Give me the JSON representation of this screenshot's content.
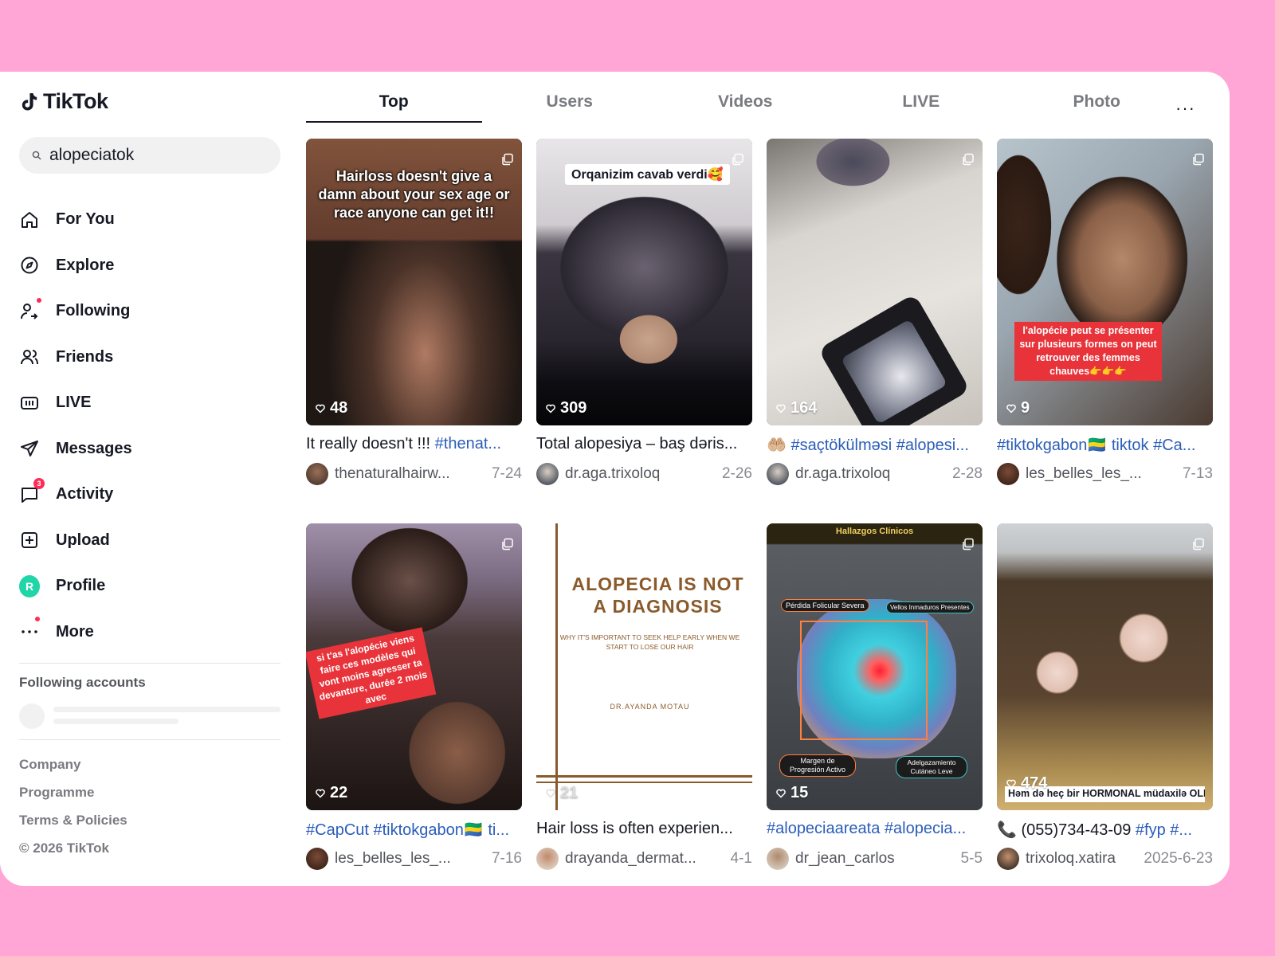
{
  "brand": {
    "name": "TikTok"
  },
  "search": {
    "query": "alopeciatok"
  },
  "nav": [
    {
      "key": "for-you",
      "label": "For You",
      "icon": "home-icon"
    },
    {
      "key": "explore",
      "label": "Explore",
      "icon": "compass-icon"
    },
    {
      "key": "following",
      "label": "Following",
      "icon": "following-icon"
    },
    {
      "key": "friends",
      "label": "Friends",
      "icon": "friends-icon"
    },
    {
      "key": "live",
      "label": "LIVE",
      "icon": "live-icon"
    },
    {
      "key": "messages",
      "label": "Messages",
      "icon": "send-icon"
    },
    {
      "key": "activity",
      "label": "Activity",
      "icon": "activity-icon",
      "badge": "3"
    },
    {
      "key": "upload",
      "label": "Upload",
      "icon": "upload-icon"
    },
    {
      "key": "profile",
      "label": "Profile",
      "icon": "profile-avatar",
      "avatar_letter": "R"
    },
    {
      "key": "more",
      "label": "More",
      "icon": "more-icon"
    }
  ],
  "following_accounts": {
    "title": "Following accounts"
  },
  "footer": [
    "Company",
    "Programme",
    "Terms & Policies",
    "© 2026 TikTok"
  ],
  "tabs": [
    "Top",
    "Users",
    "Videos",
    "LIVE",
    "Photo"
  ],
  "tabs_active": "Top",
  "tabs_more": "···",
  "videos": [
    {
      "likes": "48",
      "overlay": "Hairloss doesn't give a damn about your sex age or race anyone can get it!!",
      "caption_text": "It really doesn't !!! ",
      "caption_tags": "#thenat...",
      "user": "thenaturalhairw...",
      "date": "7-24",
      "bg": "#3a2c26"
    },
    {
      "likes": "309",
      "overlay": "Orqanizim cavab verdi🥰",
      "caption_text": "Total alopesiya – baş dəris...",
      "caption_tags": "",
      "user": "dr.aga.trixoloq",
      "date": "2-26",
      "bg": "#5a5560"
    },
    {
      "likes": "164",
      "overlay": "",
      "caption_text": "🤲🏼 ",
      "caption_tags": "#saçtökülməsi #alopesi...",
      "user": "dr.aga.trixoloq",
      "date": "2-28",
      "bg": "#b9b4ae"
    },
    {
      "likes": "9",
      "overlay": "l'alopécie peut se présenter sur plusieurs formes on peut retrouver des femmes chauves👉👉👉",
      "caption_text": "",
      "caption_tags": "#tiktokgabon🇬🇦 tiktok #Ca...",
      "user": "les_belles_les_...",
      "date": "7-13",
      "bg": "#6e5a4c"
    },
    {
      "likes": "22",
      "overlay": "si t'as l'alopécie viens faire ces modèles qui vont moins agresser ta devanture, durée 2 mois avec",
      "caption_text": "",
      "caption_tags": "#CapCut #tiktokgabon🇬🇦 ti...",
      "user": "les_belles_les_...",
      "date": "7-16",
      "bg": "#2b2120"
    },
    {
      "likes": "21",
      "overlay": "ALOPECIA IS NOT A DIAGNOSIS",
      "overlay_sub": "WHY IT'S IMPORTANT TO SEEK HELP EARLY WHEN WE START TO LOSE OUR HAIR",
      "overlay_author": "DR.AYANDA MOTAU",
      "caption_text": "Hair loss is often experien...",
      "caption_tags": "",
      "user": "drayanda_dermat...",
      "date": "4-1",
      "bg": "#ffffff"
    },
    {
      "likes": "15",
      "overlay": "Hallazgos Clínicos",
      "overlay_labels": [
        "Pérdida Folicular Severa",
        "Vellos Inmaduros Presentes",
        "Margen de Progresión Activo",
        "Adelgazamiento Cutáneo Leve"
      ],
      "caption_text": "",
      "caption_tags": "#alopeciaareata #alopecia...",
      "user": "dr_jean_carlos",
      "date": "5-5",
      "bg": "#3b4a52"
    },
    {
      "likes": "474",
      "overlay": "Həm də heç bir HORMONAL müdaxilə OLMADAN✅",
      "caption_text": "📞 (055)734-43-09 ",
      "caption_tags": "#fyp #...",
      "user": "trixoloq.xatira",
      "date": "2025-6-23",
      "bg": "#7a6040"
    }
  ],
  "colors": {
    "background": "#FFA6D6",
    "accent": "#FE2C55",
    "hashtag": "#2B5DB9",
    "profile": "#20D5A7"
  }
}
